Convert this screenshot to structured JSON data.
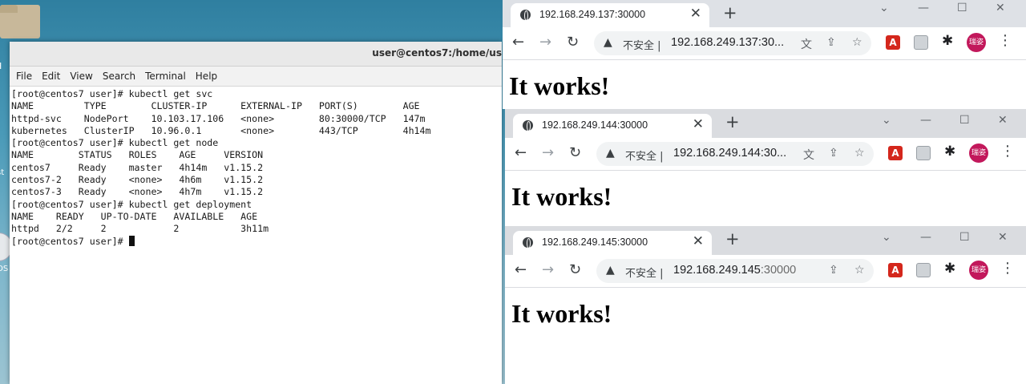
{
  "desktop": {
    "label_home": "H",
    "label_trash": "st",
    "label_os": "OS"
  },
  "terminal": {
    "title": "user@centos7:/home/us",
    "menu": [
      "File",
      "Edit",
      "View",
      "Search",
      "Terminal",
      "Help"
    ],
    "lines": [
      "[root@centos7 user]# kubectl get svc",
      "NAME         TYPE        CLUSTER-IP      EXTERNAL-IP   PORT(S)        AGE",
      "httpd-svc    NodePort    10.103.17.106   <none>        80:30000/TCP   147m",
      "kubernetes   ClusterIP   10.96.0.1       <none>        443/TCP        4h14m",
      "[root@centos7 user]# kubectl get node",
      "NAME        STATUS   ROLES    AGE     VERSION",
      "centos7     Ready    master   4h14m   v1.15.2",
      "centos7-2   Ready    <none>   4h6m    v1.15.2",
      "centos7-3   Ready    <none>   4h7m    v1.15.2",
      "[root@centos7 user]# kubectl get deployment",
      "NAME    READY   UP-TO-DATE   AVAILABLE   AGE",
      "httpd   2/2     2            2           3h11m",
      "[root@centos7 user]# "
    ]
  },
  "browsers": [
    {
      "tab_title": "192.168.249.137:30000",
      "insecure": "不安全 |",
      "url_host": "192.168.249.137:30...",
      "url_rest": "",
      "avatar": "瑞姿",
      "body": "It works!"
    },
    {
      "tab_title": "192.168.249.144:30000",
      "insecure": "不安全 |",
      "url_host": "192.168.249.144:30...",
      "url_rest": "",
      "avatar": "瑞姿",
      "body": "It works!"
    },
    {
      "tab_title": "192.168.249.145:30000",
      "insecure": "不安全 |",
      "url_host": "192.168.249.145",
      "url_rest": ":30000",
      "avatar": "瑞姿",
      "body": "It works!"
    }
  ],
  "icons": {
    "back": "←",
    "forward": "→",
    "reload": "↻",
    "close": "✕",
    "newtab": "+",
    "minimize": "—",
    "maximize": "☐",
    "chevron": "⌄",
    "warning": "▲",
    "translate": "文",
    "share": "⇪",
    "star": "☆",
    "pdf": "A",
    "puzzle": "✱",
    "menu": "⋮"
  }
}
